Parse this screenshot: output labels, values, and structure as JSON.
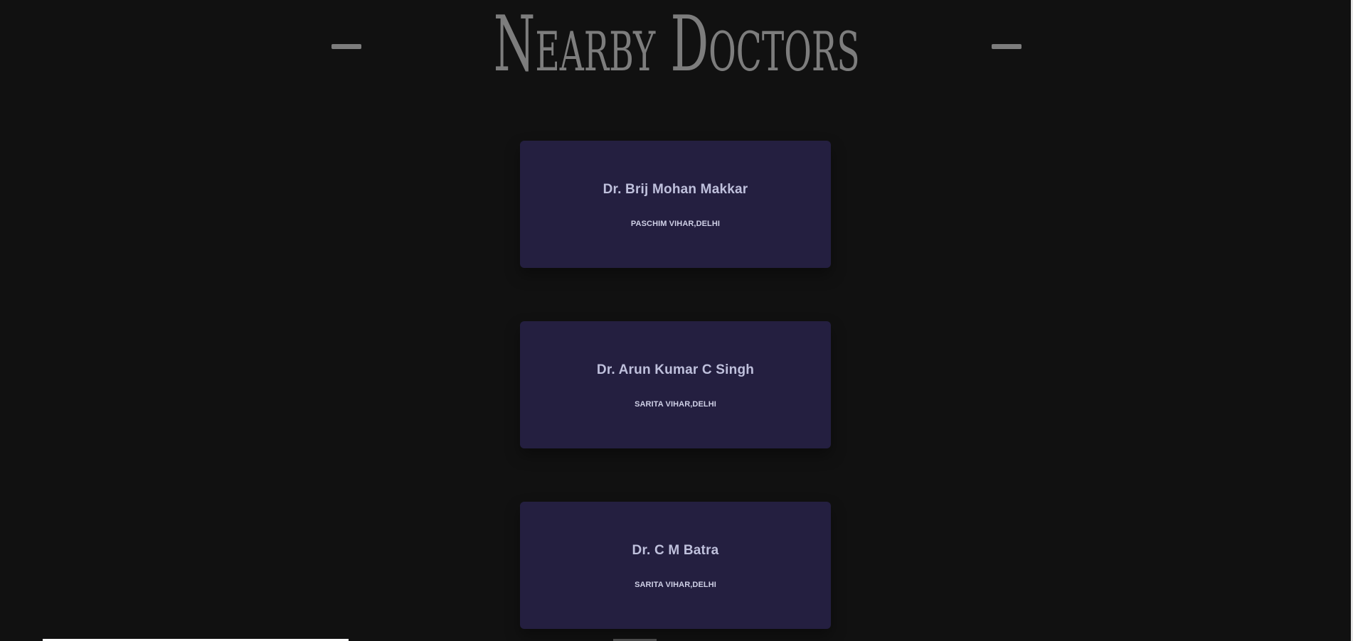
{
  "header": {
    "title": "Nearby Doctors"
  },
  "doctors": [
    {
      "name": "Dr. Brij Mohan Makkar",
      "location": "PASCHIM VIHAR,DELHI"
    },
    {
      "name": "Dr. Arun Kumar C Singh",
      "location": "SARITA VIHAR,DELHI"
    },
    {
      "name": "Dr. C M Batra",
      "location": "SARITA VIHAR,DELHI"
    }
  ],
  "colors": {
    "background": "#111111",
    "title": "#7d7d7d",
    "card": "#241f40",
    "card_text": "#bfc0dc"
  }
}
